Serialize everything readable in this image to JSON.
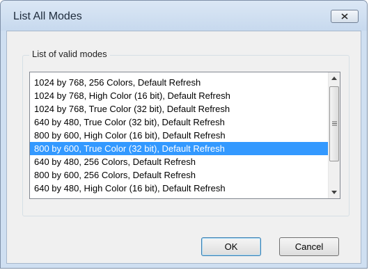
{
  "window": {
    "title": "List All Modes"
  },
  "group": {
    "label": "List of valid modes"
  },
  "modes": {
    "items": [
      "1024 by 768, 256 Colors, Default Refresh",
      "1024 by 768, High Color (16 bit), Default Refresh",
      "1024 by 768, True Color (32 bit), Default Refresh",
      "640 by 480, True Color (32 bit), Default Refresh",
      "800 by 600, High Color (16 bit), Default Refresh",
      "800 by 600, True Color (32 bit), Default Refresh",
      "640 by 480, 256 Colors, Default Refresh",
      "800 by 600, 256 Colors, Default Refresh",
      "640 by 480, High Color (16 bit), Default Refresh"
    ],
    "selected_index": 5
  },
  "buttons": {
    "ok_label": "OK",
    "cancel_label": "Cancel"
  },
  "colors": {
    "selection_bg": "#3399ff",
    "selection_text": "#ffffff",
    "title_bar": "#cfdff1"
  },
  "icons": {
    "close": "close-x-icon",
    "scroll_up": "arrow-up-icon",
    "scroll_down": "arrow-down-icon",
    "thumb_grip": "grip-icon"
  }
}
